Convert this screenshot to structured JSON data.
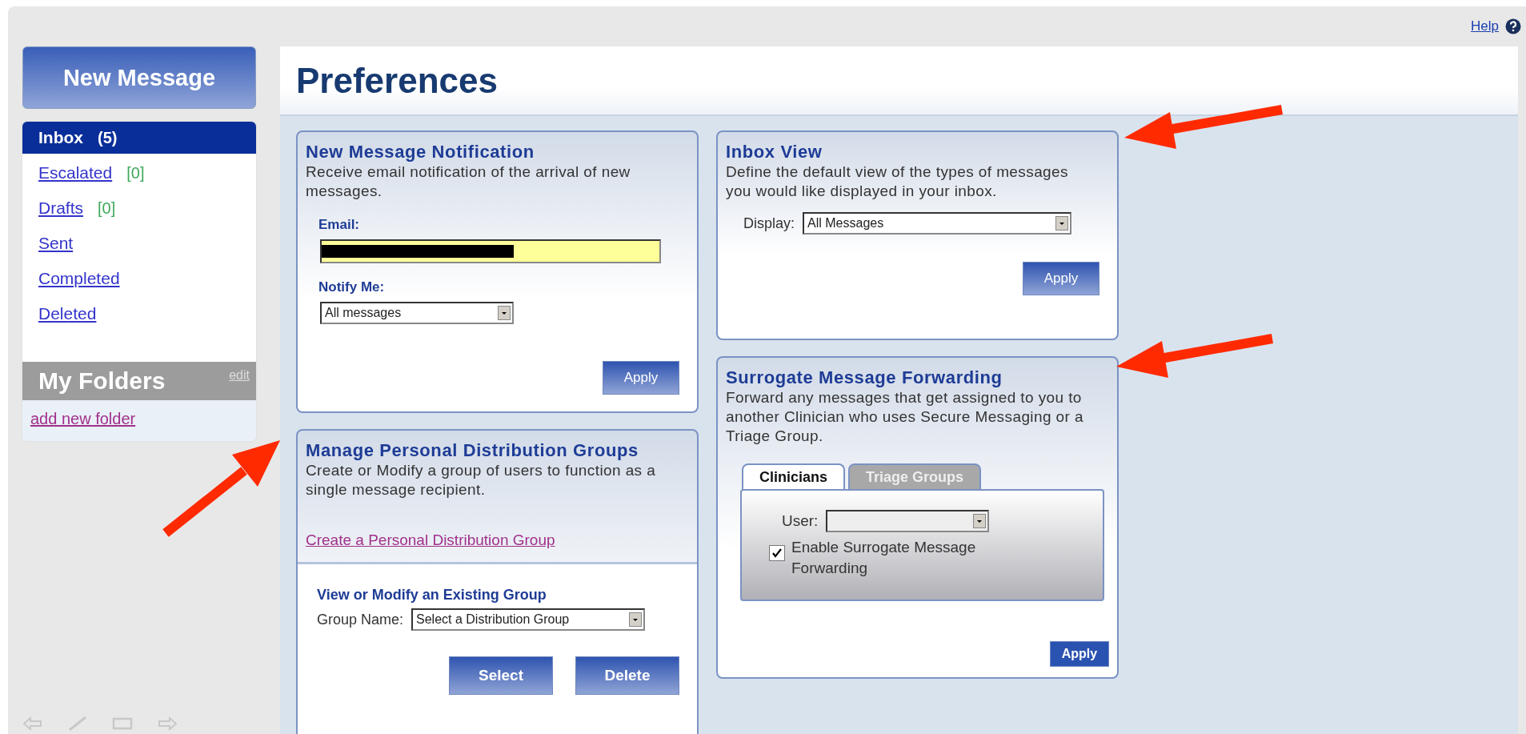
{
  "help_link": "Help",
  "sidebar": {
    "new_message_button": "New Message",
    "folders": [
      {
        "label": "Inbox",
        "count": "(5)",
        "selected": true
      },
      {
        "label": "Escalated",
        "count": "[0]",
        "selected": false
      },
      {
        "label": "Drafts",
        "count": "[0]",
        "selected": false
      },
      {
        "label": "Sent",
        "selected": false
      },
      {
        "label": "Completed",
        "selected": false
      },
      {
        "label": "Deleted",
        "selected": false
      }
    ],
    "my_folders": {
      "title": "My Folders",
      "edit_link": "edit",
      "add_link": "add new folder"
    }
  },
  "page_title": "Preferences",
  "notification": {
    "title": "New Message Notification",
    "description": "Receive email notification of the arrival of new messages.",
    "email_label": "Email:",
    "email_redacted": true,
    "notify_label": "Notify Me:",
    "notify_value": "All messages",
    "button": "Apply"
  },
  "distribution_groups": {
    "title": "Manage Personal Distribution Groups",
    "description": "Create or Modify a group of users to function as a single message recipient.",
    "create_link": "Create a Personal Distribution Group",
    "subtitle": "View or Modify an Existing Group",
    "group_label": "Group Name:",
    "group_value": "Select a Distribution Group",
    "buttons": [
      "Select",
      "Delete"
    ]
  },
  "inbox_view": {
    "title": "Inbox View",
    "description": "Define the default view of the types of messages you would like displayed in your inbox.",
    "display_label": "Display:",
    "display_value": "All Messages",
    "button": "Apply"
  },
  "surrogate": {
    "title": "Surrogate Message Forwarding",
    "description": "Forward any messages that get assigned to you to another Clinician who uses Secure Messaging or a Triage Group.",
    "tabs": [
      {
        "label": "Clinicians",
        "selected": true
      },
      {
        "label": "Triage Groups",
        "selected": false
      }
    ],
    "user_label": "User:",
    "enable_label": "Enable Surrogate Message Forwarding",
    "enable_checked": true,
    "button": "Apply"
  }
}
